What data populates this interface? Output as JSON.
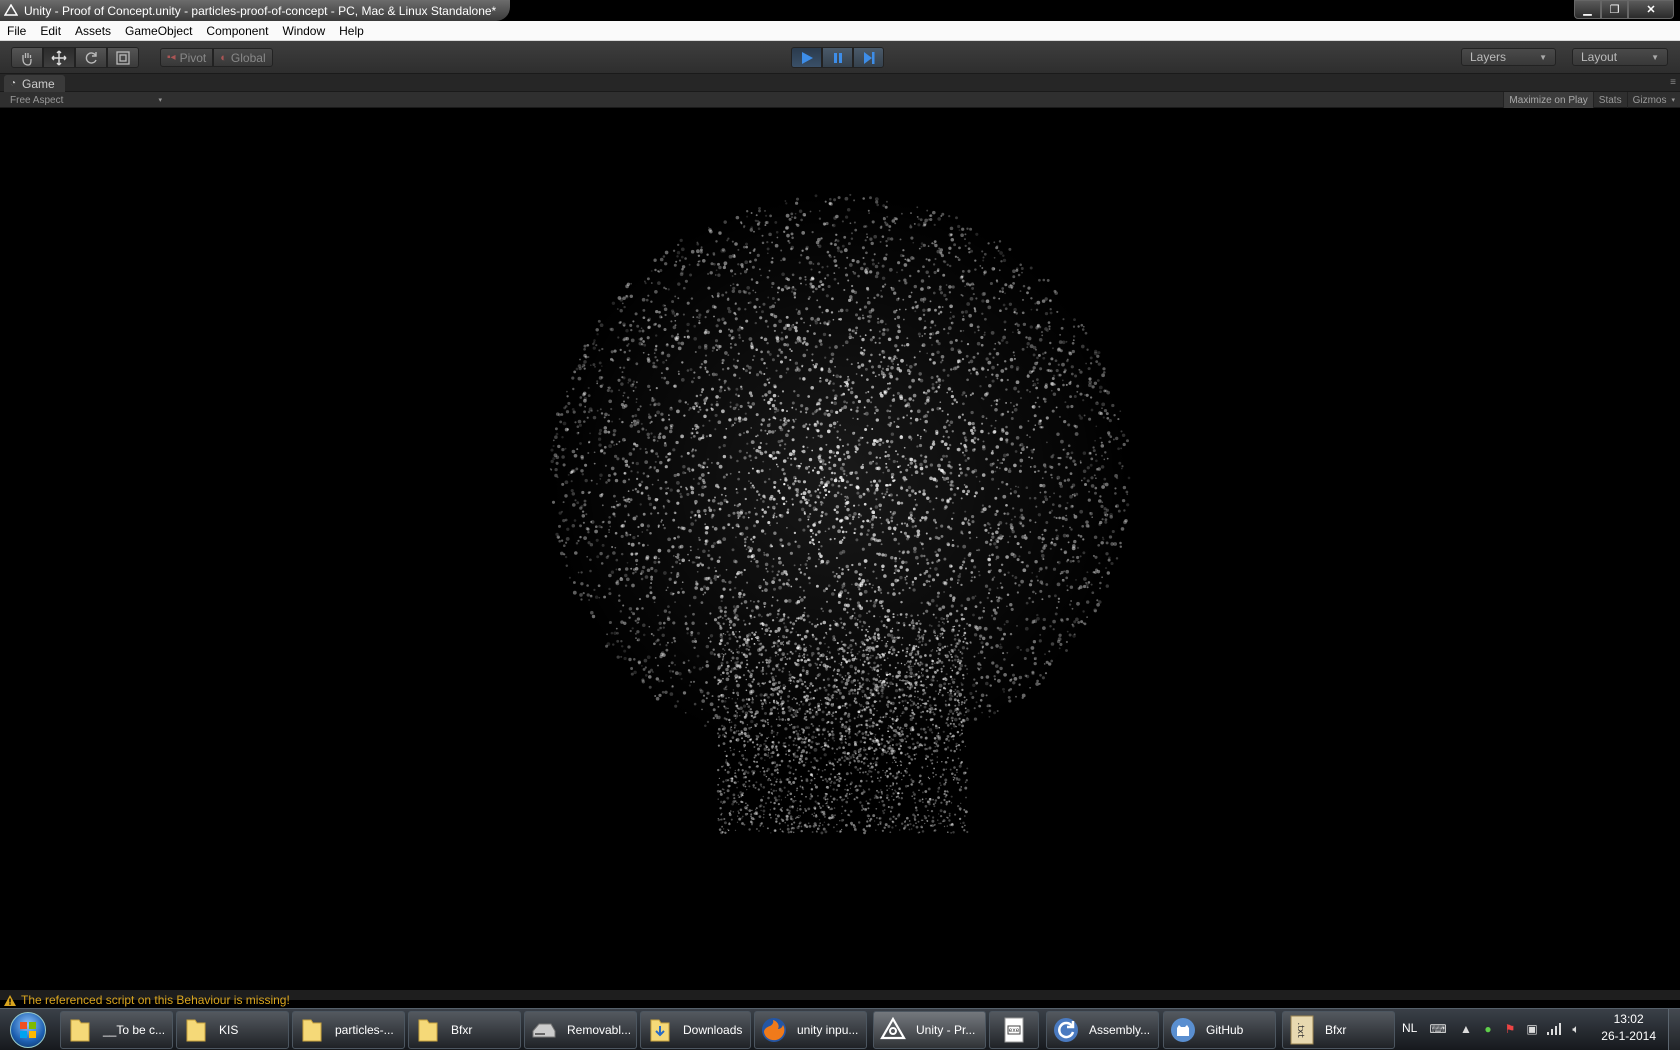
{
  "window": {
    "title": "Unity - Proof of Concept.unity - particles-proof-of-concept - PC, Mac & Linux Standalone*",
    "minimize": "▁",
    "maximize": "❐",
    "close": "✕"
  },
  "menu": [
    "File",
    "Edit",
    "Assets",
    "GameObject",
    "Component",
    "Window",
    "Help"
  ],
  "toolbar": {
    "pivot_label": "Pivot",
    "global_label": "Global",
    "layers_label": "Layers",
    "layout_label": "Layout"
  },
  "game_panel": {
    "tab_label": "Game",
    "aspect": "Free Aspect",
    "maximize_on_play": "Maximize on Play",
    "stats": "Stats",
    "gizmos": "Gizmos"
  },
  "console": {
    "warning": "The referenced script on this Behaviour is missing!"
  },
  "taskbar": {
    "items": [
      {
        "label": "__To be c...",
        "icon": "folder-icon"
      },
      {
        "label": "KIS",
        "icon": "folder-icon"
      },
      {
        "label": "particles-...",
        "icon": "folder-icon"
      },
      {
        "label": "Bfxr",
        "icon": "folder-icon"
      },
      {
        "label": "Removabl...",
        "icon": "drive-icon"
      },
      {
        "label": "Downloads",
        "icon": "folder-icon"
      },
      {
        "label": "unity inpu...",
        "icon": "firefox-icon"
      },
      {
        "label": "Unity - Pr...",
        "icon": "unity-icon"
      },
      {
        "label": "",
        "icon": "document-icon"
      },
      {
        "label": "Assembly...",
        "icon": "refresh-app-icon"
      },
      {
        "label": "GitHub",
        "icon": "github-icon"
      },
      {
        "label": "Bfxr",
        "icon": "txt-icon"
      }
    ],
    "language": "NL",
    "time": "13:02",
    "date": "26-1-2014"
  },
  "colors": {
    "warning": "#d9a51e",
    "play_accent": "#3d8de8",
    "viewport": "#000000"
  }
}
